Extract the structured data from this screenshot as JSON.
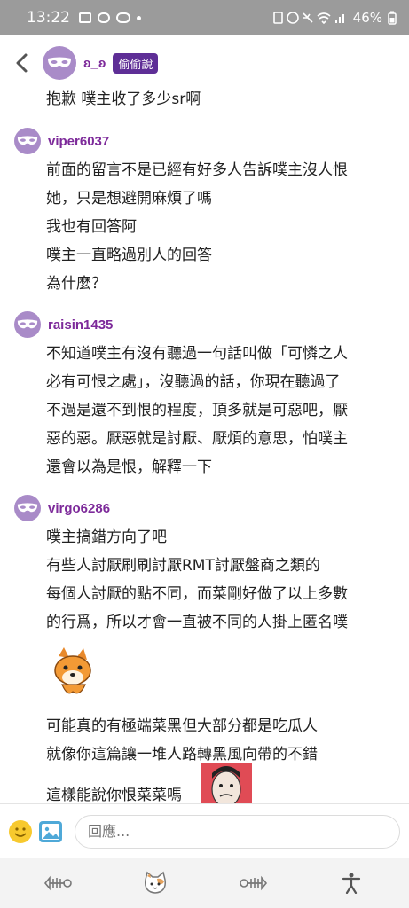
{
  "status_bar": {
    "time": "13:22",
    "battery": "46%"
  },
  "thread": [
    {
      "username": "ʚ_ʚ",
      "tag": "偷偷說",
      "lines": [
        "抱歉 噗主收了多少sr啊"
      ]
    },
    {
      "username": "viper6037",
      "lines": [
        "前面的留言不是已經有好多人告訴噗主沒人恨",
        "她，只是想避開麻煩了嗎",
        "我也有回答阿",
        "噗主一直略過別人的回答",
        "為什麼？"
      ]
    },
    {
      "username": "raisin1435",
      "lines": [
        "不知道噗主有沒有聽過一句話叫做「可憐之人",
        "必有可恨之處」，沒聽過的話，你現在聽過了",
        "不過是還不到恨的程度，頂多就是可惡吧，厭",
        "惡的惡。厭惡就是討厭、厭煩的意思，怕噗主",
        "還會以為是恨，解釋一下"
      ]
    },
    {
      "username": "virgo6286",
      "lines": [
        "噗主搞錯方向了吧",
        "有些人討厭刷刷討厭RMT討厭盤商之類的",
        "每個人討厭的點不同，而菜剛好做了以上多數",
        "的行爲，所以才會一直被不同的人掛上匿名噗"
      ],
      "lines_after_sticker": [
        "可能真的有極端菜黑但大部分都是吃瓜人",
        "就像你這篇讓一堆人路轉黑風向帶的不錯"
      ],
      "partial_line": "這樣能說你恨菜菜嗎"
    }
  ],
  "composer": {
    "placeholder": "回應..."
  },
  "nav": [
    "fish-bone-icon",
    "cat-icon",
    "fish-bone-icon",
    "accessibility-icon"
  ]
}
